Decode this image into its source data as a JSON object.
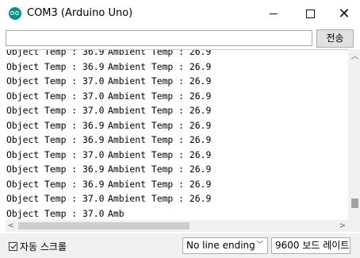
{
  "window": {
    "title": "COM3 (Arduino Uno)"
  },
  "titlebar_controls": {
    "minimize": "minimize",
    "maximize": "maximize",
    "close": "✕"
  },
  "send": {
    "input_value": "",
    "button_label": "전송"
  },
  "serial_lines": [
    {
      "obj": "Object Temp : 36.9",
      "amb": "Ambient Temp : 26.9"
    },
    {
      "obj": "Object Temp : 36.9",
      "amb": "Ambient Temp : 26.9"
    },
    {
      "obj": "Object Temp : 37.0",
      "amb": "Ambient Temp : 26.9"
    },
    {
      "obj": "Object Temp : 37.0",
      "amb": "Ambient Temp : 26.9"
    },
    {
      "obj": "Object Temp : 37.0",
      "amb": "Ambient Temp : 26.9"
    },
    {
      "obj": "Object Temp : 36.9",
      "amb": "Ambient Temp : 26.9"
    },
    {
      "obj": "Object Temp : 36.9",
      "amb": "Ambient Temp : 26.9"
    },
    {
      "obj": "Object Temp : 37.0",
      "amb": "Ambient Temp : 26.9"
    },
    {
      "obj": "Object Temp : 36.9",
      "amb": "Ambient Temp : 26.9"
    },
    {
      "obj": "Object Temp : 36.9",
      "amb": "Ambient Temp : 26.9"
    },
    {
      "obj": "Object Temp : 37.0",
      "amb": "Ambient Temp : 26.9"
    },
    {
      "obj": "Object Temp : 37.0",
      "amb": "Amb"
    }
  ],
  "status": {
    "autoscroll_label": "자동 스크롤",
    "autoscroll_checked": true,
    "line_ending": "No line ending",
    "baud_rate": "9600 보드 레이트"
  },
  "icons": {
    "app": "arduino-icon",
    "dropdown": "chevron-down-icon"
  }
}
